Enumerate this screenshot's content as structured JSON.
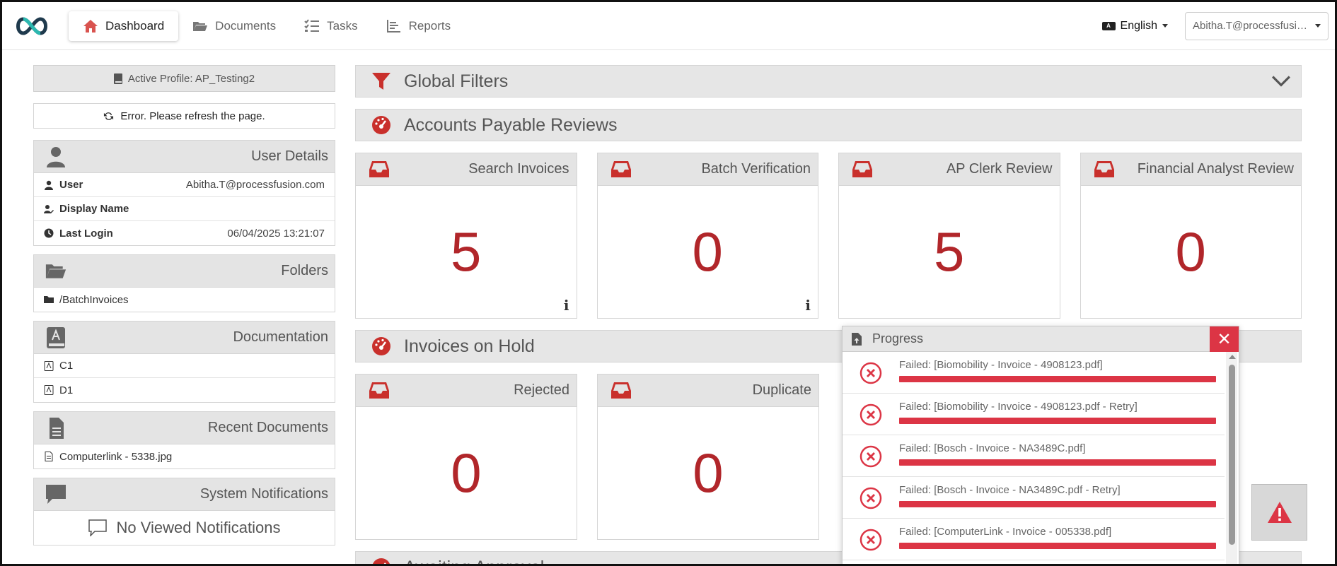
{
  "nav": {
    "items": [
      {
        "label": "Dashboard",
        "icon": "home-icon",
        "active": true
      },
      {
        "label": "Documents",
        "icon": "folder-open-icon"
      },
      {
        "label": "Tasks",
        "icon": "task-list-icon"
      },
      {
        "label": "Reports",
        "icon": "bar-chart-icon"
      }
    ],
    "language": "English",
    "user": "Abitha.T@processfusion..."
  },
  "sidebar": {
    "active_profile": "Active Profile: AP_Testing2",
    "error_message": "Error. Please refresh the page.",
    "user_details": {
      "title": "User Details",
      "rows": [
        {
          "label": "User",
          "value": "Abitha.T@processfusion.com"
        },
        {
          "label": "Display Name",
          "value": ""
        },
        {
          "label": "Last Login",
          "value": "06/04/2025 13:21:07"
        }
      ]
    },
    "folders": {
      "title": "Folders",
      "items": [
        "/BatchInvoices"
      ]
    },
    "documentation": {
      "title": "Documentation",
      "items": [
        "C1",
        "D1"
      ]
    },
    "recent_documents": {
      "title": "Recent Documents",
      "items": [
        "Computerlink - 5338.jpg"
      ]
    },
    "system_notifications": {
      "title": "System Notifications",
      "empty_text": "No Viewed Notifications"
    }
  },
  "main": {
    "global_filters": "Global Filters",
    "ap_reviews": {
      "title": "Accounts Payable Reviews",
      "cards": [
        {
          "title": "Search Invoices",
          "count": "5",
          "info": "i"
        },
        {
          "title": "Batch Verification",
          "count": "0",
          "info": "i"
        },
        {
          "title": "AP Clerk Review",
          "count": "5"
        },
        {
          "title": "Financial Analyst Review",
          "count": "0"
        }
      ]
    },
    "invoices_on_hold": {
      "title": "Invoices on Hold",
      "cards": [
        {
          "title": "Rejected",
          "count": "0"
        },
        {
          "title": "Duplicate",
          "count": "0"
        }
      ]
    },
    "awaiting_approval": "Awaiting Approval"
  },
  "progress": {
    "title": "Progress",
    "close": "✕",
    "items": [
      {
        "text": "Failed: [Biomobility - Invoice - 4908123.pdf]",
        "progress": 1.0
      },
      {
        "text": "Failed: [Biomobility - Invoice - 4908123.pdf - Retry]",
        "progress": 1.0
      },
      {
        "text": "Failed: [Bosch - Invoice - NA3489C.pdf]",
        "progress": 1.0
      },
      {
        "text": "Failed: [Bosch - Invoice - NA3489C.pdf - Retry]",
        "progress": 1.0
      },
      {
        "text": "Failed: [ComputerLink - Invoice - 005338.pdf]",
        "progress": 1.0
      }
    ]
  },
  "colors": {
    "accent_red": "#b1262a",
    "error_red": "#dc3545",
    "panel_gray": "#e4e4e4"
  }
}
